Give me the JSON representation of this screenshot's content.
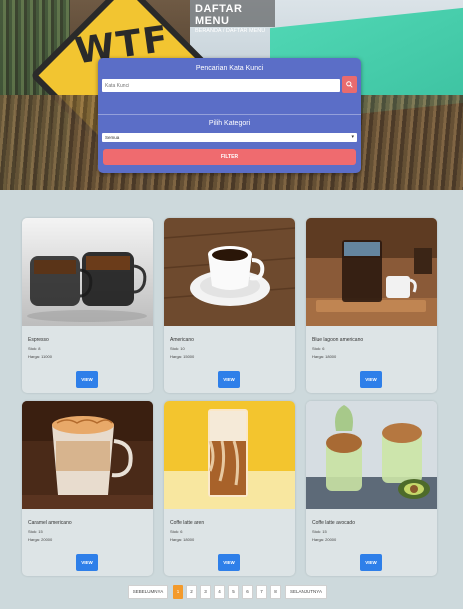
{
  "header": {
    "title": "DAFTAR MENU",
    "breadcrumb": "BERANDA / DAFTAR MENU",
    "hero_sign_text": "WTF"
  },
  "search": {
    "keyword_label": "Pencarian Kata Kunci",
    "keyword_placeholder": "Kata Kunci",
    "category_label": "Pilih Kategori",
    "category_value": "Semua",
    "filter_label": "FILTER"
  },
  "products": [
    {
      "name": "Espresso",
      "stok": "Stok: 8",
      "harga": "Harga: 11000",
      "view": "VIEW"
    },
    {
      "name": "Americano",
      "stok": "Stok: 10",
      "harga": "Harga: 15000",
      "view": "VIEW"
    },
    {
      "name": "Blue lagoon americano",
      "stok": "Stok: 6",
      "harga": "Harga: 18000",
      "view": "VIEW"
    },
    {
      "name": "Caramel americano",
      "stok": "Stok: 15",
      "harga": "Harga: 20000",
      "view": "VIEW"
    },
    {
      "name": "Coffe latte aren",
      "stok": "Stok: 6",
      "harga": "Harga: 18000",
      "view": "VIEW"
    },
    {
      "name": "Coffe latte avocado",
      "stok": "Stok: 15",
      "harga": "Harga: 20000",
      "view": "VIEW"
    }
  ],
  "pagination": {
    "prev": "SEBELUMNYA",
    "pages": [
      "1",
      "2",
      "3",
      "4",
      "5",
      "6",
      "7",
      "8"
    ],
    "active_page": "1",
    "next": "SELANJUTNYA"
  },
  "colors": {
    "panel": "#5b6ec7",
    "accent_red": "#ef6b6f",
    "view_button": "#2e7fe9",
    "page_active": "#f39a2b",
    "background": "#cdd9dc"
  }
}
